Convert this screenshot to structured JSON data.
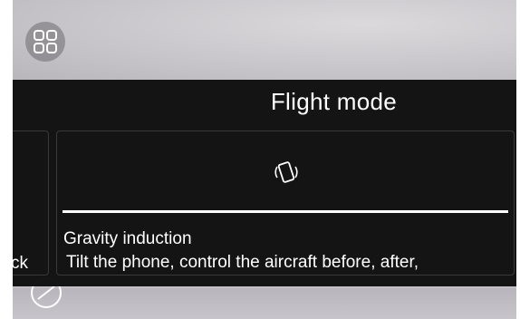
{
  "panel": {
    "title": "Flight mode"
  },
  "modes": [
    {
      "label_fragment": "ck"
    },
    {
      "name": "Gravity induction",
      "description": "Tilt the phone, control the aircraft before, after,",
      "icon": "phone-rotate-icon",
      "selected": true
    }
  ],
  "toolbar": {
    "grid_icon": "grid-icon",
    "compass_icon": "compass-icon"
  },
  "colors": {
    "panel_background": "#0c0c0c",
    "text": "#ffffff",
    "card_border": "#3a3a3a",
    "selection_bar": "#ffffff"
  }
}
